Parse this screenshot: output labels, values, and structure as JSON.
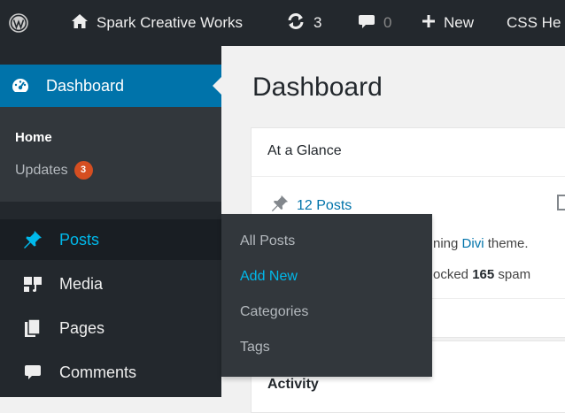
{
  "adminbar": {
    "site_name": "Spark Creative Works",
    "updates_count": "3",
    "comments_count": "0",
    "new_label": "New",
    "css_label": "CSS He"
  },
  "sidebar": {
    "dashboard_label": "Dashboard",
    "submenu": {
      "home": "Home",
      "updates": "Updates",
      "updates_badge": "3"
    },
    "items": [
      {
        "label": "Posts",
        "icon": "pushpin-icon"
      },
      {
        "label": "Media",
        "icon": "media-icon"
      },
      {
        "label": "Pages",
        "icon": "pages-icon"
      },
      {
        "label": "Comments",
        "icon": "comment-bubble-icon"
      }
    ]
  },
  "flyout": {
    "items": [
      "All Posts",
      "Add New",
      "Categories",
      "Tags"
    ],
    "current_index": 1
  },
  "main": {
    "page_title": "Dashboard",
    "glance": {
      "title": "At a Glance",
      "posts_link": "12 Posts",
      "theme_prefix": "ning ",
      "theme_link": "Divi",
      "theme_suffix": " theme.",
      "spam_prefix": "ocked ",
      "spam_count": "165",
      "spam_suffix": " spam"
    },
    "activity_title": "Activity"
  },
  "colors": {
    "adminbar_bg": "#23282d",
    "active_blue": "#0073aa",
    "link_blue": "#00b9eb",
    "badge": "#d54e21"
  }
}
